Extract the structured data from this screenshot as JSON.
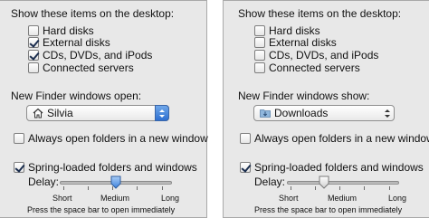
{
  "panels": [
    {
      "show_heading": "Show these items on the desktop:",
      "items": [
        {
          "label": "Hard disks",
          "checked": false
        },
        {
          "label": "External disks",
          "checked": true
        },
        {
          "label": "CDs, DVDs, and iPods",
          "checked": true
        },
        {
          "label": "Connected servers",
          "checked": false
        }
      ],
      "finder_heading": "New Finder windows open:",
      "finder_value": "Silvia",
      "finder_icon": "home-icon",
      "always_open": {
        "label": "Always open folders in a new window",
        "checked": false
      },
      "spring_loaded": {
        "label": "Spring-loaded folders and windows",
        "checked": true
      },
      "delay_label": "Delay:",
      "delay_level": 0.5,
      "short_label": "Short",
      "medium_label": "Medium",
      "long_label": "Long",
      "hint": "Press the space bar to open immediately"
    },
    {
      "show_heading": "Show these items on the desktop:",
      "items": [
        {
          "label": "Hard disks",
          "checked": false
        },
        {
          "label": "External disks",
          "checked": false
        },
        {
          "label": "CDs, DVDs, and iPods",
          "checked": false
        },
        {
          "label": "Connected servers",
          "checked": false
        }
      ],
      "finder_heading": "New Finder windows show:",
      "finder_value": "Downloads",
      "finder_icon": "folder-icon",
      "always_open": {
        "label": "Always open folders in a new window",
        "checked": false
      },
      "spring_loaded": {
        "label": "Spring-loaded folders and windows",
        "checked": true
      },
      "delay_label": "Delay:",
      "delay_level": 0.32,
      "short_label": "Short",
      "medium_label": "Medium",
      "long_label": "Long",
      "hint": "Press the space bar to open immediately"
    }
  ],
  "colors": {
    "panel_bg": "#e8e8e8",
    "select_blue": "#2e6fd1",
    "check_mark": "#1a2d4e"
  }
}
